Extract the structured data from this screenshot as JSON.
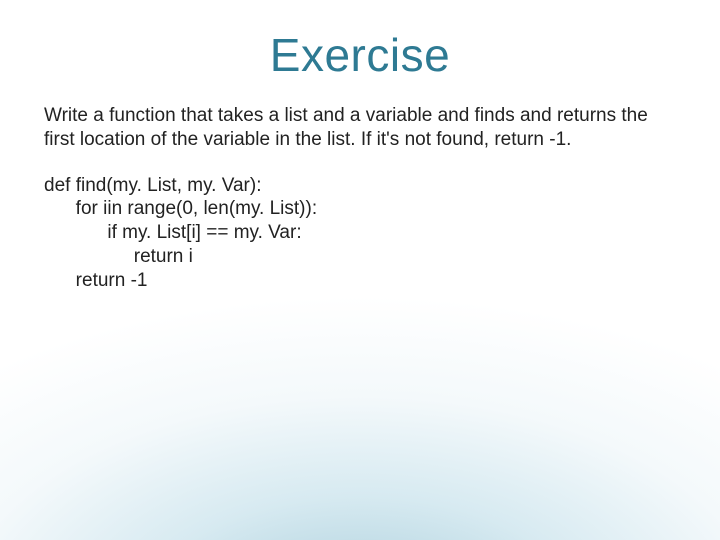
{
  "slide": {
    "title": "Exercise",
    "description": "Write a function that takes a list and a variable and finds and returns the first location of the variable in the list.  If it's not found, return -1.",
    "code": "def find(my. List, my. Var):\n      for iin range(0, len(my. List)):\n            if my. List[i] == my. Var:\n                 return i\n      return -1"
  }
}
